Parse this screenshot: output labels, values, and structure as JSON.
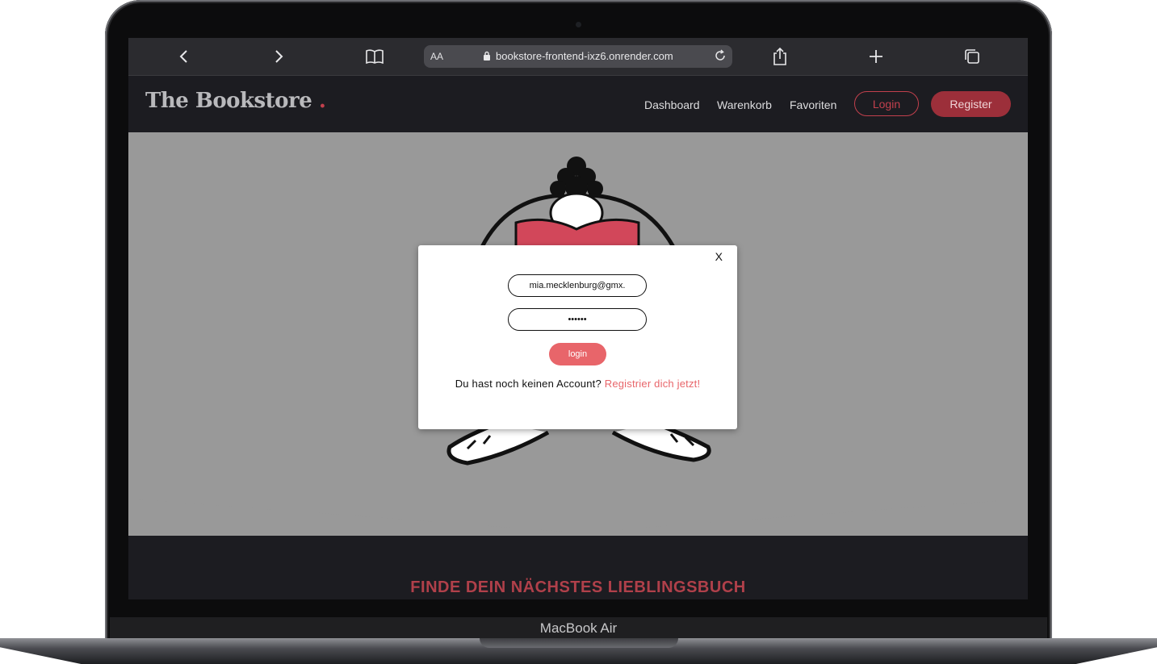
{
  "device": {
    "label": "MacBook Air"
  },
  "browser": {
    "aa_label": "AA",
    "url": "bookstore-frontend-ixz6.onrender.com",
    "icons": [
      "back-icon",
      "forward-icon",
      "bookmarks-icon",
      "lock-icon",
      "reload-icon",
      "share-icon",
      "new-tab-icon",
      "tabs-icon"
    ]
  },
  "site": {
    "brand": "The Bookstore",
    "brand_dot": ".",
    "nav": {
      "dashboard": "Dashboard",
      "cart": "Warenkorb",
      "favorites": "Favoriten",
      "login": "Login",
      "register": "Register"
    },
    "headline": "FINDE DEIN NÄCHSTES LIEBLINGSBUCH",
    "colors": {
      "accent": "#c2404d",
      "hero_bg": "#999999",
      "nav_bg": "#1c1c21"
    }
  },
  "modal": {
    "close": "X",
    "email_value": "mia.mecklenburg@gmx.",
    "password_value": "••••••",
    "login_button": "login",
    "prompt": "Du hast noch keinen Account?",
    "register_link": "Registrier dich jetzt!"
  }
}
